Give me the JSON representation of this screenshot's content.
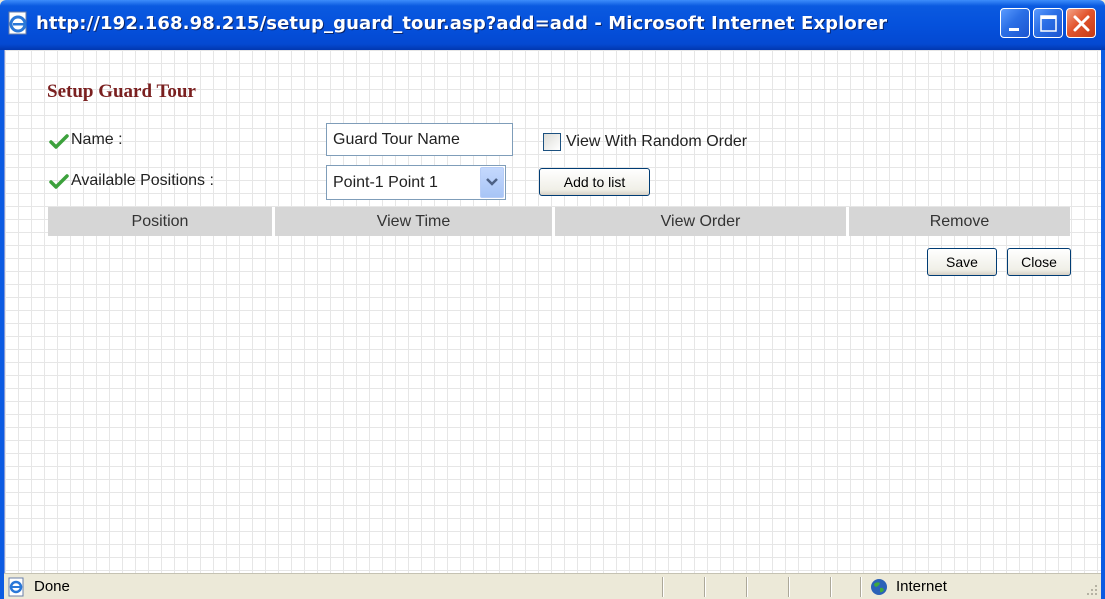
{
  "window": {
    "title": "http://192.168.98.215/setup_guard_tour.asp?add=add - Microsoft Internet Explorer",
    "title_color": "#ffffff",
    "titlebar_color": "#0551dc",
    "controls": [
      "minimize-icon",
      "maximize-icon",
      "close-icon"
    ]
  },
  "form": {
    "title": "Setup Guard Tour",
    "title_color": "#7a1f1f",
    "name_label": "Name :",
    "name_value": "Guard Tour Name",
    "random_order_label": "View With Random Order",
    "random_order_checked": false,
    "positions_label": "Available Positions :",
    "positions_selected": "Point-1  Point 1",
    "add_button": "Add to list"
  },
  "table": {
    "columns": [
      "Position",
      "View Time",
      "View Order",
      "Remove"
    ],
    "rows": []
  },
  "actions": {
    "save": "Save",
    "close": "Close"
  },
  "statusbar": {
    "status": "Done",
    "zone": "Internet"
  }
}
